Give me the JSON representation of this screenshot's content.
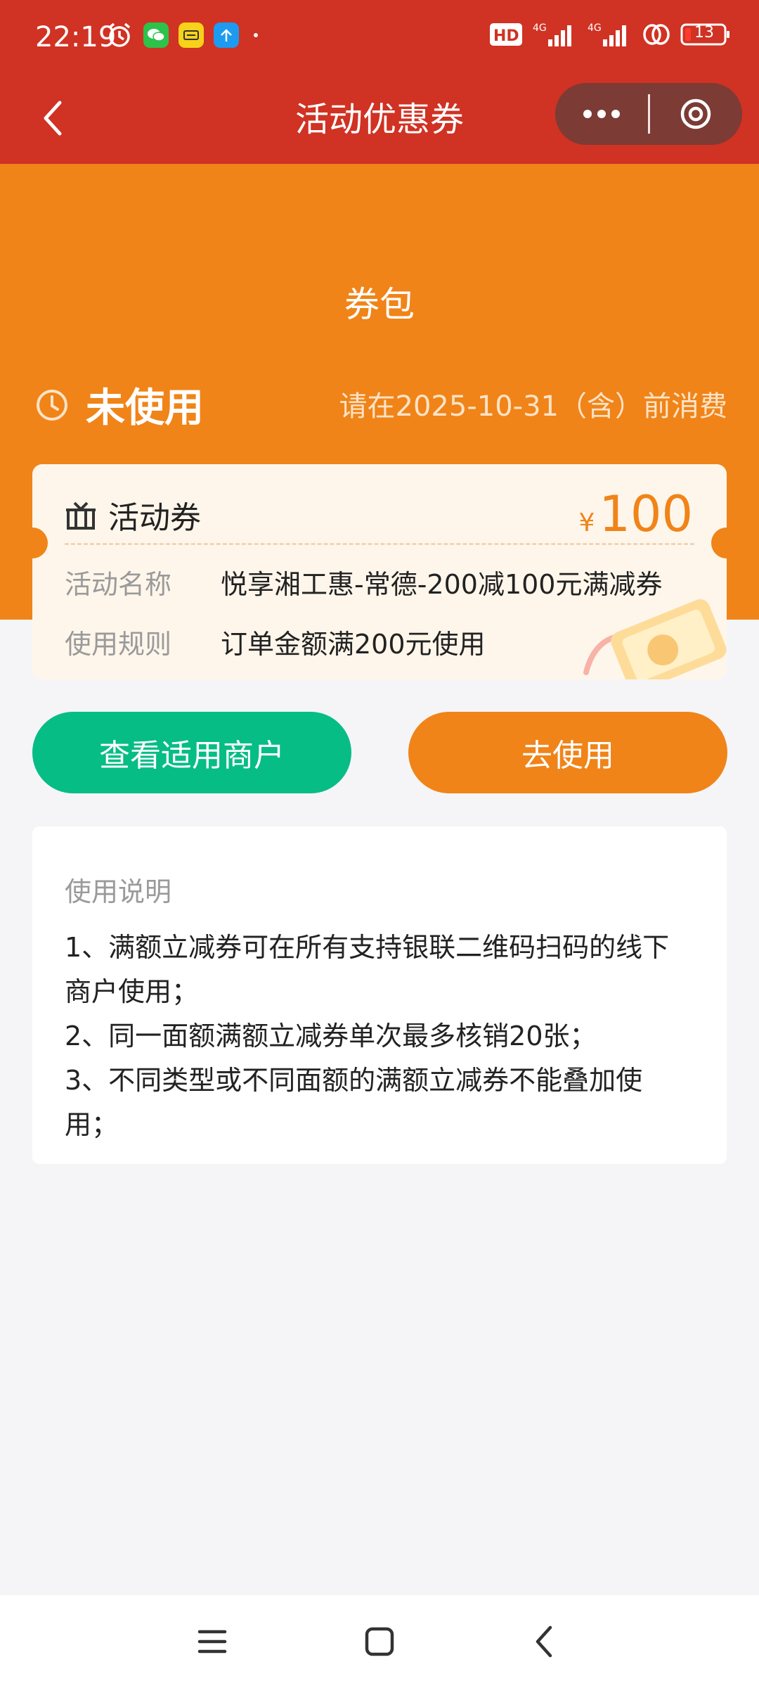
{
  "status_bar": {
    "time": "22:19",
    "left_icons": [
      "alarm-icon",
      "wechat-icon",
      "app-icon",
      "upload-icon",
      "dot"
    ],
    "battery": "13",
    "network": [
      "HD",
      "4G",
      "4G"
    ]
  },
  "navbar": {
    "title": "活动优惠券"
  },
  "header": {
    "title": "券包",
    "status": "未使用",
    "expire_note": "请在2025-10-31（含）前消费"
  },
  "coupon": {
    "type_label": "活动券",
    "currency": "¥",
    "amount": "100",
    "rows": [
      {
        "key": "活动名称",
        "value": "悦享湘工惠-常德-200减100元满减券"
      },
      {
        "key": "使用规则",
        "value": "订单金额满200元使用"
      }
    ]
  },
  "buttons": {
    "merchants": "查看适用商户",
    "use": "去使用"
  },
  "instructions": {
    "title": "使用说明",
    "items": [
      "1、满额立减券可在所有支持银联二维码扫码的线下商户使用；",
      "2、同一面额满额立减券单次最多核销20张；",
      "3、不同类型或不同面额的满额立减券不能叠加使用；"
    ]
  },
  "colors": {
    "nav_red": "#d03223",
    "orange": "#f08418",
    "green": "#06bd85"
  }
}
